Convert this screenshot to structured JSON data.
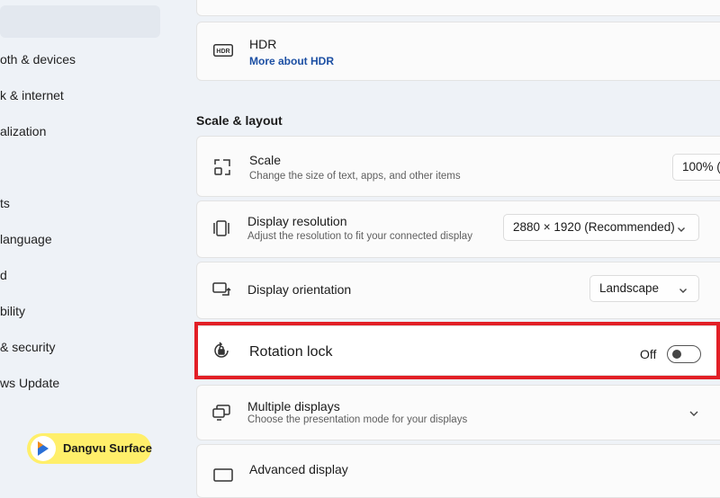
{
  "sidebar": {
    "items": [
      {
        "label": "oth & devices"
      },
      {
        "label": "k & internet"
      },
      {
        "label": "alization"
      },
      {
        "label": "ts"
      },
      {
        "label": "language"
      },
      {
        "label": "d"
      },
      {
        "label": "bility"
      },
      {
        "label": "& security"
      },
      {
        "label": "ws Update"
      }
    ]
  },
  "hdr": {
    "title": "HDR",
    "link": "More about HDR"
  },
  "section": {
    "title": "Scale & layout"
  },
  "scale": {
    "title": "Scale",
    "subtitle": "Change the size of text, apps, and other items",
    "value": "100% ("
  },
  "resolution": {
    "title": "Display resolution",
    "subtitle": "Adjust the resolution to fit your connected display",
    "value": "2880 × 1920 (Recommended)"
  },
  "orientation": {
    "title": "Display orientation",
    "value": "Landscape"
  },
  "rotation": {
    "title": "Rotation lock",
    "state": "Off",
    "toggle_on": false
  },
  "multiple": {
    "title": "Multiple displays",
    "subtitle": "Choose the presentation mode for your displays"
  },
  "advanced": {
    "title": "Advanced display"
  },
  "watermark": {
    "text": "Dangvu Surface"
  },
  "colors": {
    "highlight": "#e21f26",
    "badge": "#ffef6a",
    "link": "#1c4fa3"
  }
}
